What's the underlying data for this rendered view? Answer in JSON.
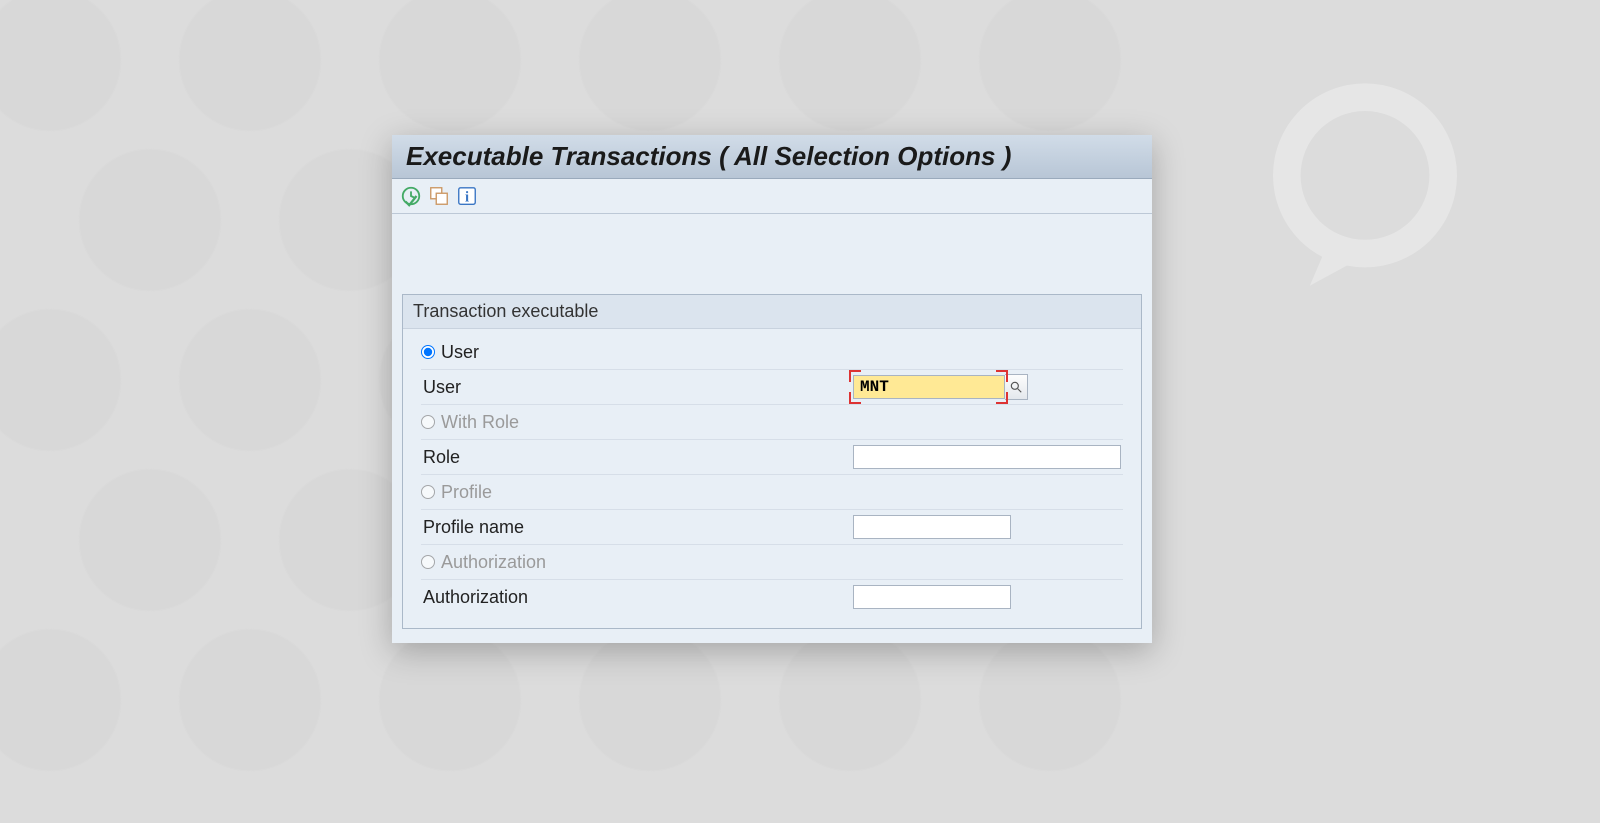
{
  "window": {
    "title": "Executable Transactions ( All Selection Options )"
  },
  "toolbar": {
    "icons": {
      "execute": "execute-clock-icon",
      "variant": "get-variant-icon",
      "info": "info-icon"
    }
  },
  "group": {
    "title": "Transaction executable",
    "options": {
      "user": {
        "radio_label": "User",
        "field_label": "User",
        "value": "MNT",
        "selected": true
      },
      "with_role": {
        "radio_label": "With Role",
        "field_label": "Role",
        "value": "",
        "selected": false
      },
      "profile": {
        "radio_label": "Profile",
        "field_label": "Profile name",
        "value": "",
        "selected": false
      },
      "authorization": {
        "radio_label": "Authorization",
        "field_label": "Authorization",
        "value": "",
        "selected": false
      }
    }
  }
}
